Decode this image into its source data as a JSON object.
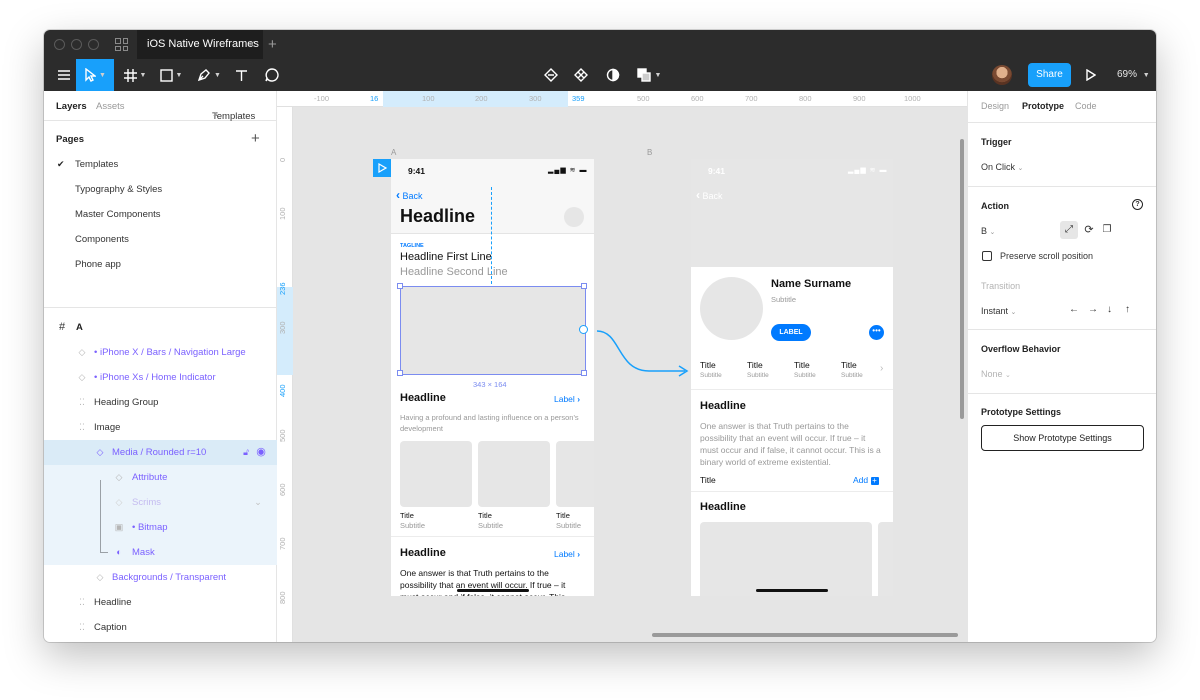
{
  "titlebar": {
    "tab_title": "iOS Native Wireframes",
    "tab_close": "×",
    "new_tab": "+"
  },
  "toolbar": {
    "share_label": "Share",
    "zoom": "69%"
  },
  "left_panel": {
    "tabs": {
      "layers": "Layers",
      "assets": "Assets",
      "templates": "Templates"
    },
    "pages_header": "Pages",
    "pages": [
      "Templates",
      "Typography & Styles",
      "Master Components",
      "Components",
      "Phone app"
    ],
    "frame_name": "A",
    "layers": [
      "• iPhone X / Bars / Navigation Large",
      "• iPhone Xs / Home Indicator",
      "Heading Group",
      "Image",
      "Media / Rounded r=10",
      "Attribute",
      "Scrims",
      "• Bitmap",
      "Mask",
      "Backgrounds / Transparent",
      "Headline",
      "Caption"
    ]
  },
  "rulers": {
    "top": [
      "-100",
      "16",
      "100",
      "200",
      "300",
      "359",
      "500",
      "600",
      "700",
      "800",
      "900",
      "1000"
    ],
    "left": [
      "0",
      "100",
      "236",
      "300",
      "400",
      "500",
      "600",
      "700",
      "800"
    ]
  },
  "frame_a": {
    "label": "A",
    "time": "9:41",
    "back": "Back",
    "headline": "Headline",
    "tagline": "TAGLINE",
    "line1": "Headline First Line",
    "line2": "Headline Second Line",
    "size": "343 × 164",
    "section1": {
      "title": "Headline",
      "action": "Label",
      "body": "Having a profound and lasting influence on a person's development"
    },
    "cards": [
      {
        "title": "Title",
        "subtitle": "Subtitle"
      },
      {
        "title": "Title",
        "subtitle": "Subtitle"
      },
      {
        "title": "Title",
        "subtitle": "Subtitle"
      }
    ],
    "section2": {
      "title": "Headline",
      "action": "Label",
      "body": "One answer is that Truth pertains to the possibility that an event will occur. If true – it must occur and if false, it cannot occur. This"
    }
  },
  "frame_b": {
    "label": "B",
    "time": "9:41",
    "back": "Back",
    "name": "Name Surname",
    "subtitle": "Subtitle",
    "label_btn": "LABEL",
    "stats": [
      {
        "title": "Title",
        "subtitle": "Subtitle"
      },
      {
        "title": "Title",
        "subtitle": "Subtitle"
      },
      {
        "title": "Title",
        "subtitle": "Subtitle"
      },
      {
        "title": "Title",
        "subtitle": "Subtitle"
      }
    ],
    "headline1": "Headline",
    "body": "One answer is that Truth pertains to the possibility that an event will occur. If true – it must occur and if false, it cannot occur. This is a binary world of extreme existential.",
    "row_title": "Title",
    "row_action": "Add",
    "headline2": "Headline"
  },
  "right_panel": {
    "tabs": {
      "design": "Design",
      "prototype": "Prototype",
      "code": "Code"
    },
    "trigger_label": "Trigger",
    "trigger_value": "On Click",
    "action_label": "Action",
    "action_dest": "B",
    "preserve_scroll": "Preserve scroll position",
    "transition_label": "Transition",
    "transition_value": "Instant",
    "overflow_label": "Overflow Behavior",
    "overflow_value": "None",
    "proto_settings_label": "Prototype Settings",
    "proto_settings_btn": "Show Prototype Settings"
  },
  "colors": {
    "accent": "#18a0fb",
    "ios_blue": "#007aff",
    "component_purple": "#7b61ff",
    "toolbar_bg": "#2c2c2c",
    "canvas_bg": "#e5e5e5",
    "placeholder_gray": "#e6e6e6"
  }
}
